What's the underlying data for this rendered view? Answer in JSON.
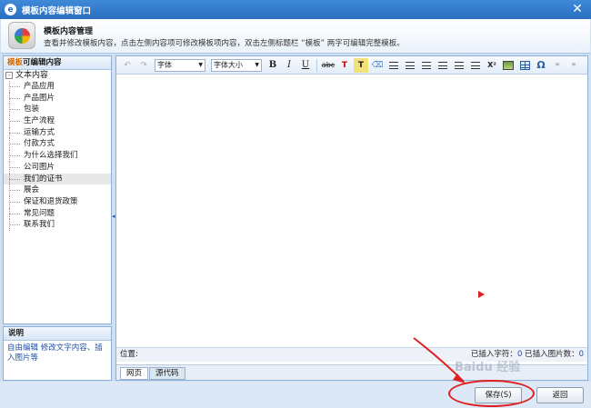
{
  "window": {
    "title": "模板内容编辑窗口",
    "close_glyph": "✕"
  },
  "header": {
    "title": "模板内容管理",
    "description": "查看并修改模板内容，点击左侧内容项可修改模板项内容，双击左侧标题栏 “模板” 两字可编辑完整模板。"
  },
  "left_panel": {
    "title_accent": "模板",
    "title_rest": "可编辑内容",
    "root": {
      "expander": "-",
      "label": "文本内容"
    },
    "items": [
      "产品应用",
      "产品图片",
      "包装",
      "生产流程",
      "运输方式",
      "付款方式",
      "为什么选择我们",
      "公司图片",
      "我们的证书",
      "展会",
      "保证和退货政策",
      "常见问题",
      "联系我们"
    ],
    "selected_index": 8
  },
  "help": {
    "title": "说明",
    "text": "自由编辑 修改文字内容、插入图片等"
  },
  "toolbar": {
    "undo": "↶",
    "redo": "↷",
    "font_placeholder": "字体",
    "size_placeholder": "字体大小",
    "bold": "B",
    "italic": "I",
    "underline": "U",
    "strike": "abc",
    "forecolor": "T",
    "backcolor": "T",
    "eraser": "⌫",
    "superscript": "X²",
    "omega": "Ω",
    "link": "⚭"
  },
  "status": {
    "position_label": "位置:",
    "inserted_text_label": "已插入字符：",
    "inserted_text_count": "0",
    "inserted_images_label": "已插入图片数：",
    "inserted_images_count": "0"
  },
  "tabs": [
    "网页",
    "源代码"
  ],
  "footer": {
    "save": "保存(S)",
    "back": "返回"
  },
  "watermark": "Baidu 经验",
  "colors": {
    "accent": "#2a6fc0",
    "annotation": "#e02020"
  }
}
